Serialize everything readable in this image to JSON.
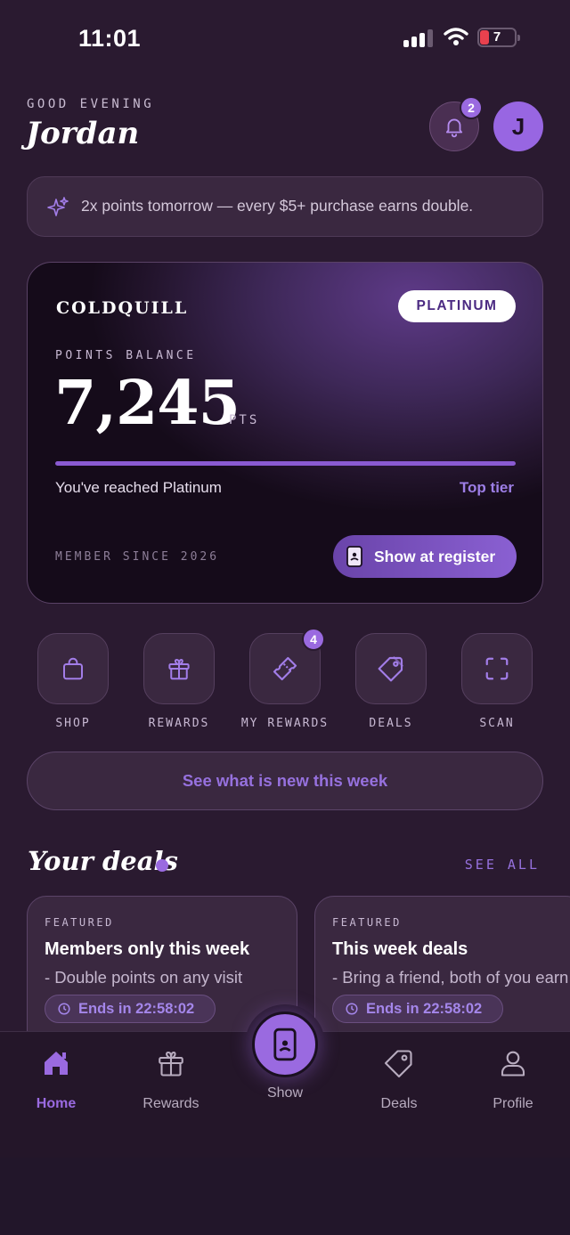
{
  "status_bar": {
    "time": "11:01",
    "battery": "7"
  },
  "header": {
    "greeting": "GOOD EVENING",
    "name": "Jordan",
    "notification_count": "2",
    "avatar_initial": "J"
  },
  "banner": {
    "text": "2x points tomorrow — every $5+ purchase earns double."
  },
  "card": {
    "brand": "COLDQUILL",
    "tier": "PLATINUM",
    "points_label": "POINTS BALANCE",
    "points": "7,245",
    "points_unit": "PTS",
    "progress_percent": 100,
    "status_text": "You've reached Platinum",
    "tier_note": "Top tier",
    "member_since": "MEMBER SINCE 2026",
    "show_button": "Show at register"
  },
  "quick_actions": [
    {
      "label": "SHOP",
      "icon": "shopping-bag-icon"
    },
    {
      "label": "REWARDS",
      "icon": "gift-icon"
    },
    {
      "label": "MY REWARDS",
      "icon": "ticket-icon",
      "badge": "4"
    },
    {
      "label": "DEALS",
      "icon": "tag-icon"
    },
    {
      "label": "SCAN",
      "icon": "scan-frame-icon"
    }
  ],
  "whats_new": "See what is new this week",
  "deals_section": {
    "title": "Your deals",
    "see_all": "SEE ALL"
  },
  "deals": [
    {
      "tag": "FEATURED",
      "title": "Members only this week",
      "subtitle": "- Double points on any visit",
      "timer": "Ends in 22:58:02"
    },
    {
      "tag": "FEATURED",
      "title": "This week deals",
      "subtitle": "- Bring a friend, both of you earn",
      "timer": "Ends in 22:58:02"
    }
  ],
  "nav": {
    "home": "Home",
    "rewards": "Rewards",
    "show": "Show",
    "deals": "Deals",
    "profile": "Profile"
  },
  "colors": {
    "accent": "#9a6ae0",
    "background": "#2a1a30",
    "card_surface": "#3a2840"
  }
}
